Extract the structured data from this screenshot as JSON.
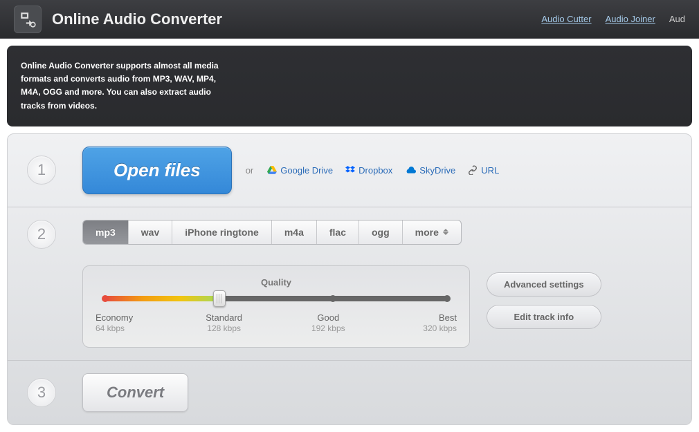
{
  "header": {
    "title": "Online Audio Converter",
    "nav": [
      "Audio Cutter",
      "Audio Joiner",
      "Aud"
    ]
  },
  "description": "Online Audio Converter supports almost all media formats and converts audio from MP3, WAV, MP4, M4A, OGG and more. You can also extract audio tracks from videos.",
  "step1": {
    "open": "Open files",
    "or": "or",
    "sources": {
      "gdrive": "Google Drive",
      "dropbox": "Dropbox",
      "skydrive": "SkyDrive",
      "url": "URL"
    }
  },
  "step2": {
    "formats": [
      "mp3",
      "wav",
      "iPhone ringtone",
      "m4a",
      "flac",
      "ogg",
      "more"
    ],
    "active": "mp3",
    "quality": {
      "title": "Quality",
      "levels": [
        {
          "label": "Economy",
          "rate": "64 kbps"
        },
        {
          "label": "Standard",
          "rate": "128 kbps"
        },
        {
          "label": "Good",
          "rate": "192 kbps"
        },
        {
          "label": "Best",
          "rate": "320 kbps"
        }
      ],
      "selected": "Standard"
    },
    "advanced": "Advanced settings",
    "editTrack": "Edit track info"
  },
  "step3": {
    "convert": "Convert"
  }
}
